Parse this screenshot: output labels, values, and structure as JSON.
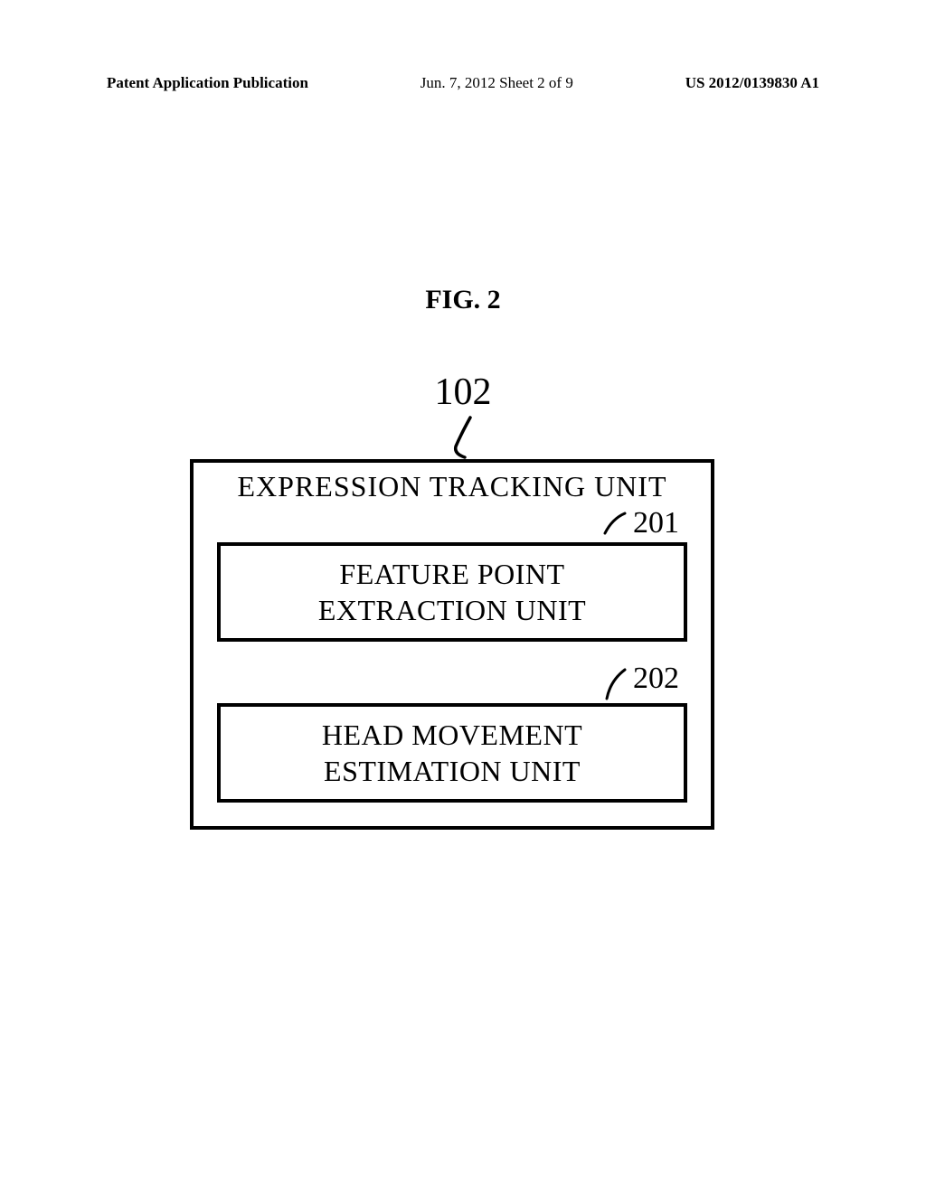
{
  "header": {
    "left": "Patent Application Publication",
    "center": "Jun. 7, 2012  Sheet 2 of 9",
    "right": "US 2012/0139830 A1"
  },
  "figure": {
    "title": "FIG. 2",
    "ref_main": "102",
    "outer_title": "EXPRESSION TRACKING UNIT",
    "box1": {
      "ref": "201",
      "line1": "FEATURE POINT",
      "line2": "EXTRACTION UNIT"
    },
    "box2": {
      "ref": "202",
      "line1": "HEAD MOVEMENT",
      "line2": "ESTIMATION UNIT"
    }
  }
}
